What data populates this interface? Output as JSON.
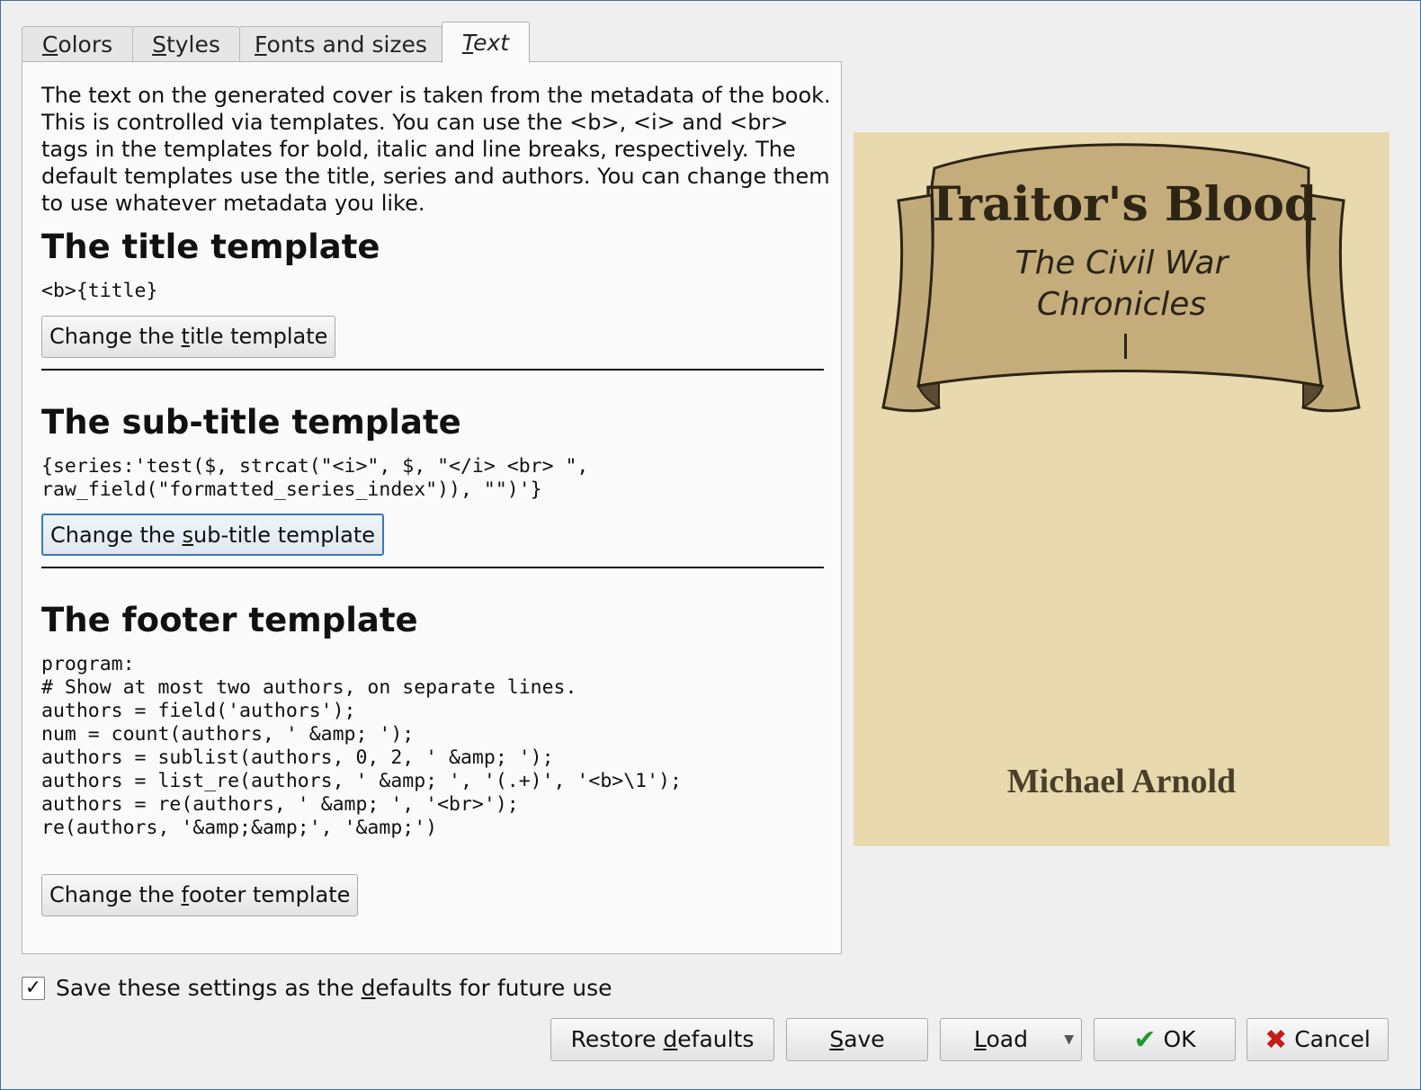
{
  "tabs": [
    {
      "label_pre": "",
      "label_u": "C",
      "label_post": "olors"
    },
    {
      "label_pre": "",
      "label_u": "S",
      "label_post": "tyles"
    },
    {
      "label_pre": "",
      "label_u": "F",
      "label_post": "onts and sizes"
    },
    {
      "label_pre": "",
      "label_u": "T",
      "label_post": "ext"
    }
  ],
  "intro": "The text on the generated cover is taken from the metadata of the book. This is controlled via templates. You can use the <b>, <i> and <br> tags in the templates for bold, italic and line breaks, respectively. The default templates use the title, series and authors. You can change them to use whatever metadata you like.",
  "title_section": {
    "heading": "The title template",
    "template": "<b>{title}",
    "button": {
      "pre": "Change the ",
      "u": "t",
      "post": "itle template"
    }
  },
  "subtitle_section": {
    "heading": "The sub-title template",
    "template": "{series:'test($, strcat(\"<i>\", $, \"</i> <br> \",\nraw_field(\"formatted_series_index\")), \"\")'}",
    "button": {
      "pre": "Change the ",
      "u": "s",
      "post": "ub-title template"
    }
  },
  "footer_section": {
    "heading": "The footer template",
    "template": "program:\n# Show at most two authors, on separate lines.\nauthors = field('authors');\nnum = count(authors, ' &amp; ');\nauthors = sublist(authors, 0, 2, ' &amp; ');\nauthors = list_re(authors, ' &amp; ', '(.+)', '<b>\\1');\nauthors = re(authors, ' &amp; ', '<br>');\nre(authors, '&amp;&amp;', '&amp;')",
    "button": {
      "pre": "Change the ",
      "u": "f",
      "post": "ooter template"
    }
  },
  "cover": {
    "title": "Traitor's Blood",
    "subtitle": "The Civil War Chronicles",
    "author": "Michael Arnold"
  },
  "save_defaults": {
    "pre": "Save these settings as the ",
    "u": "d",
    "post": "efaults for future use",
    "checked": "✓"
  },
  "buttons": {
    "restore": {
      "pre": "Restore ",
      "u": "d",
      "post": "efaults"
    },
    "save": {
      "pre": "",
      "u": "S",
      "post": "ave"
    },
    "load": {
      "pre": "",
      "u": "L",
      "post": "oad"
    },
    "ok": "OK",
    "cancel": "Cancel"
  },
  "icons": {
    "ok": "check-icon",
    "cancel": "x-icon",
    "dropdown": "chevron-down-icon"
  }
}
